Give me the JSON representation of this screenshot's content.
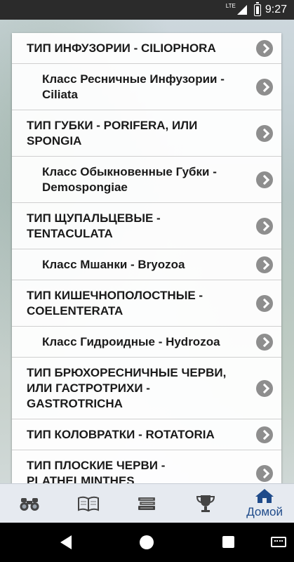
{
  "status_bar": {
    "network": "LTE",
    "time": "9:27"
  },
  "list_items": [
    {
      "label": "ТИП ИНФУЗОРИИ - CILIOPHORA",
      "kind": "type"
    },
    {
      "label": "Класс Ресничные Инфузории - Ciliata",
      "kind": "class"
    },
    {
      "label": "ТИП ГУБКИ - PORIFERA, ИЛИ SPONGIA",
      "kind": "type"
    },
    {
      "label": "Класс Обыкновенные Губки - Demospongiae",
      "kind": "class"
    },
    {
      "label": "ТИП ЩУПАЛЬЦЕВЫЕ - TENTACULATA",
      "kind": "type"
    },
    {
      "label": "Класс Мшанки - Bryozoa",
      "kind": "class"
    },
    {
      "label": "ТИП КИШЕЧНОПОЛОСТНЫЕ - COELENTERATA",
      "kind": "type"
    },
    {
      "label": "Класс Гидроидные - Hydrozoa",
      "kind": "class"
    },
    {
      "label": "ТИП БРЮХОРЕСНИЧНЫЕ ЧЕРВИ, ИЛИ ГАСТРОТРИХИ - GASTROTRICHA",
      "kind": "type"
    },
    {
      "label": "ТИП КОЛОВРАТКИ - ROTATORIA",
      "kind": "type"
    },
    {
      "label": "ТИП ПЛОСКИЕ ЧЕРВИ - PLATHELMINTHES",
      "kind": "type"
    }
  ],
  "tab_bar": {
    "tabs": [
      {
        "icon": "binoculars-icon"
      },
      {
        "icon": "open-book-icon"
      },
      {
        "icon": "books-stack-icon"
      },
      {
        "icon": "trophy-icon"
      },
      {
        "icon": "home-icon",
        "label": "Домой",
        "active": true
      }
    ]
  },
  "colors": {
    "accent": "#1f4b8a",
    "chevron": "#8e8e8e"
  }
}
